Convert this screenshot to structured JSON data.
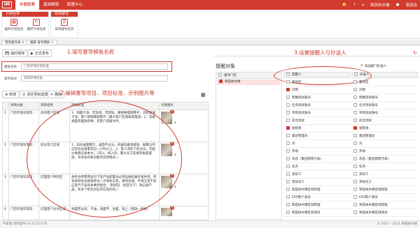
{
  "topbar": {
    "logo": "IM",
    "nav": [
      "计划任务",
      "基础数据",
      "配置中心"
    ],
    "user": "和田扶木楼",
    "user2": "张丽洁"
  },
  "ribbon": {
    "group1_title": "计划任务",
    "group1_buttons": [
      "临时计划任务",
      "循环计划任务"
    ],
    "group2_title": "现场督导",
    "group2_buttons": [
      "现场督导任务"
    ]
  },
  "tabs": [
    "现场督导表",
    "编辑 督导模板"
  ],
  "annotations": {
    "a1": "1.填写督导模板名称",
    "a2": "2.编辑督导项目、项目标准、示例图片等",
    "a3": "3.设置提醒人与抄送人"
  },
  "left": {
    "save": "临时保存",
    "publish": "正式发布",
    "name_label": "模板名称",
    "name_value": "门店环境日常检查",
    "remark_label": "督导描述",
    "remark_placeholder": "现场环境检查",
    "add": "新增",
    "clear": "清空项目选择",
    "delete": "删除",
    "columns": [
      "项目分类",
      "项目名称",
      "项目标准",
      "示例图片"
    ],
    "rows": [
      {
        "no": "1",
        "cat": "门店环境日常检...",
        "name": "前场客户区域",
        "std": "1、地面干净，无淘渣，无积垢，重物要摆放整齐，货柜玻璃干净，客户座椅摆放整齐（最大客户区域角度摆放）2、花瓶桌面无摆放杂物，无客户遗留文件。"
      },
      {
        "no": "2",
        "cat": "门店环境日常检...",
        "name": "前台及工区域",
        "std": "1、前台桌面整洁，桌面不过分，机器设备须摆放、报警与开启前台设备需开启一小时以上。2、客人须向个前台员，无超过收银记录本文，（可以，如入内，最大员工区域的角度摆放，有多处的知识服务反馈格式。）"
      },
      {
        "no": "3",
        "cat": "门店环境日常检...",
        "name": "店面客户制作区",
        "std": "各柜台所需用品包下连产品配置也必须设备机器检查并且，所有如何各合格请各位一点清各信息，保持合理，不清洁且不适应及严产品有关事务配合。（制作区（各区包下）须记录产品，有多个柜台对应的信息形状。）"
      },
      {
        "no": "4",
        "cat": "门店环境日常检...",
        "name": "店面客户业务区域",
        "std": "地面无垃圾，不油，地面平，台面，墙上（摆放一类格）"
      }
    ]
  },
  "right": {
    "title": "提醒对象",
    "send_btn": "添加部门抄送人",
    "col_org": "督导门店",
    "col_remind": "提醒人",
    "col_cc": "抄送人",
    "org": "和田扶木楼",
    "people": [
      {
        "r": "督导区",
        "c": "督导区",
        "ron": false,
        "con": false
      },
      {
        "r": "刘明",
        "c": "刘明",
        "ron": true,
        "con": false
      },
      {
        "r": "明确测试账号",
        "c": "明确测试账号",
        "ron": false,
        "con": false
      },
      {
        "r": "任务测试账号",
        "c": "任务测试账号",
        "ron": false,
        "con": false
      },
      {
        "r": "项目测试账号",
        "c": "项目测试账号",
        "ron": false,
        "con": false
      },
      {
        "r": "前台测试",
        "c": "前台测试",
        "ron": false,
        "con": false
      },
      {
        "r": "张晓清",
        "c": "张晓清",
        "ron": true,
        "con": true
      },
      {
        "r": "集团管理员",
        "c": "集团管理员",
        "ron": false,
        "con": false
      },
      {
        "r": "刘",
        "c": "刘",
        "ron": false,
        "con": false
      },
      {
        "r": "罗助",
        "c": "罗助",
        "ron": false,
        "con": false
      },
      {
        "r": "浩昌（集团销售代表）",
        "c": "浩昌（集团销售代表）",
        "ron": false,
        "con": false
      },
      {
        "r": "任务",
        "c": "任务",
        "ron": false,
        "con": false
      },
      {
        "r": "测试工",
        "c": "测试工",
        "ron": false,
        "con": false
      },
      {
        "r": "测试员工",
        "c": "测试员工",
        "ron": false,
        "con": false
      },
      {
        "r": "和田扶木楼区域经理",
        "c": "和田扶木楼区域经理",
        "ron": false,
        "con": false
      },
      {
        "r": "ERP客户测试",
        "c": "ERP客户测试",
        "ron": false,
        "con": false
      },
      {
        "r": "和田扶木楼区域管理",
        "c": "和田扶木楼区域管理",
        "ron": false,
        "con": false
      },
      {
        "r": "和田扶木楼区域测试",
        "c": "和田扶木楼区域测试",
        "ron": false,
        "con": false
      }
    ]
  },
  "footer": {
    "left": "牛掌柜-巡检督导 V1.0.210729",
    "right": "© 2017 - 2021 和田扶木楼"
  }
}
